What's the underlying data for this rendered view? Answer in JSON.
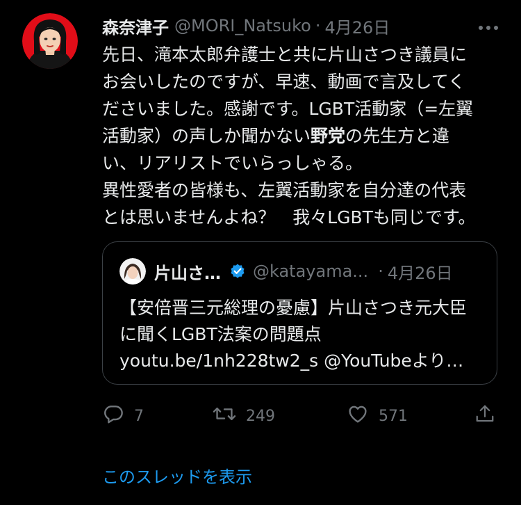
{
  "tweet": {
    "author_name": "森奈津子",
    "handle": "@MORI_Natsuko",
    "separator": "·",
    "date": "4月26日",
    "more_icon": "more-dots-icon",
    "lines": [
      "先日、滝本太郎弁護士と共に片山さつき議員に",
      "お会いしたのですが、早速、動画で言及してく",
      "ださいました。感謝です。LGBT活動家（=左翼",
      "活動家）の声しか聞かない",
      "野党",
      "の先生方と違",
      "い、リアリストでいらっしゃる。",
      "異性愛者の皆様も、左翼活動家を自分達の代表",
      "とは思いませんよね？　我々LGBTも同じです。"
    ]
  },
  "quoted_tweet": {
    "author_name": "片山さ…",
    "verified_icon": "verified-badge-icon",
    "handle": "@katayama...",
    "separator": "·",
    "date": "4月26日",
    "lines": [
      "【安倍晋三元総理の憂慮】片山さつき元大臣",
      "に聞くLGBT法案の問題点",
      "youtu.be/1nh228tw2_s @YouTubeより…"
    ]
  },
  "actions": {
    "reply_count": "7",
    "retweet_count": "249",
    "like_count": "571"
  },
  "thread_link": "このスレッドを表示",
  "colors": {
    "background": "#000000",
    "text": "#e7e9ea",
    "secondary": "#71767b",
    "accent": "#1d9bf0",
    "border": "#3b4045"
  }
}
